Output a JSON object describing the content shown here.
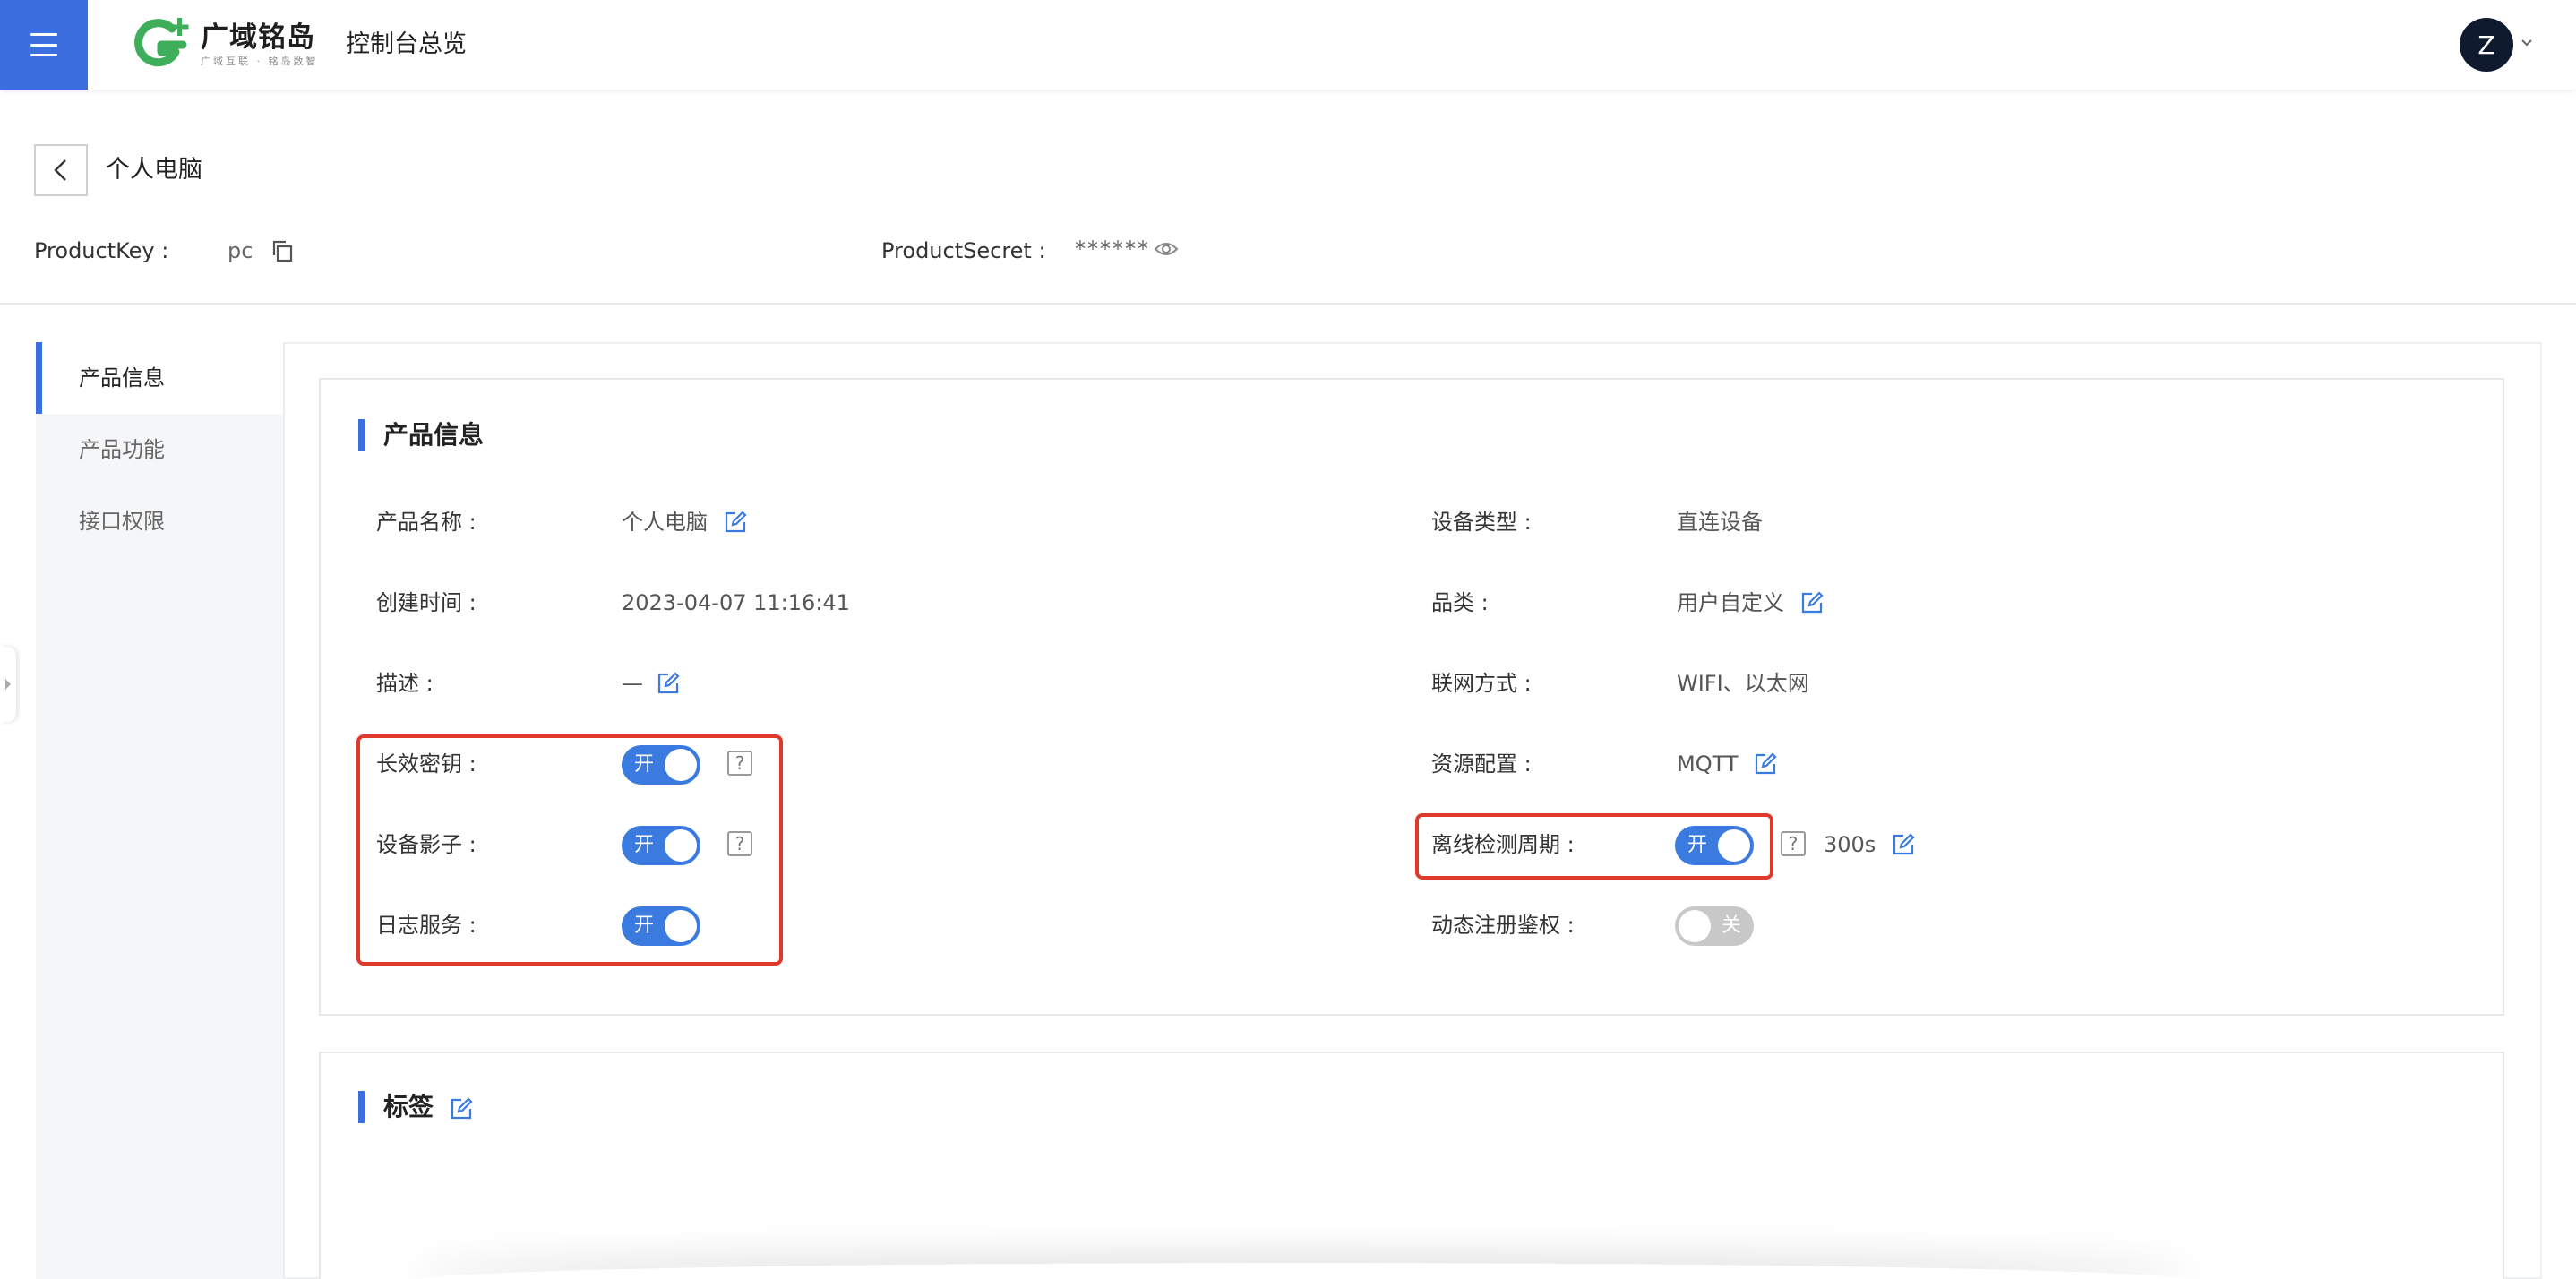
{
  "header": {
    "brand_name": "广域铭岛",
    "brand_slogan": "广域互联 · 铭岛数智",
    "title": "控制台总览",
    "avatar_initial": "Z",
    "accent_color": "#3b6fe0"
  },
  "page": {
    "title": "个人电脑",
    "product_key_label": "ProductKey :",
    "product_key_value": "pc",
    "product_secret_label": "ProductSecret :",
    "product_secret_value": "******"
  },
  "leftnav": {
    "items": [
      {
        "label": "产品信息",
        "active": true
      },
      {
        "label": "产品功能",
        "active": false
      },
      {
        "label": "接口权限",
        "active": false
      }
    ]
  },
  "product_info": {
    "section_title": "产品信息",
    "left": {
      "name_label": "产品名称 :",
      "name_value": "个人电脑",
      "created_label": "创建时间 :",
      "created_value": "2023-04-07 11:16:41",
      "desc_label": "描述 :",
      "desc_value": "—",
      "long_key_label": "长效密钥 :",
      "long_key_toggle": "开",
      "shadow_label": "设备影子 :",
      "shadow_toggle": "开",
      "log_label": "日志服务 :",
      "log_toggle": "开"
    },
    "right": {
      "device_type_label": "设备类型 :",
      "device_type_value": "直连设备",
      "category_label": "品类 :",
      "category_value": "用户自定义",
      "network_label": "联网方式 :",
      "network_value": "WIFI、以太网",
      "resource_label": "资源配置 :",
      "resource_value": "MQTT",
      "offline_label": "离线检测周期 :",
      "offline_toggle": "开",
      "offline_value": "300s",
      "dynamic_label": "动态注册鉴权 :",
      "dynamic_toggle": "关"
    },
    "help_glyph": "?"
  },
  "tags": {
    "section_title": "标签"
  },
  "colors": {
    "toggle_on": "#3b7be0",
    "toggle_off": "#c8c8c8",
    "highlight": "#e0382a",
    "logo_green": "#3fae5a"
  }
}
